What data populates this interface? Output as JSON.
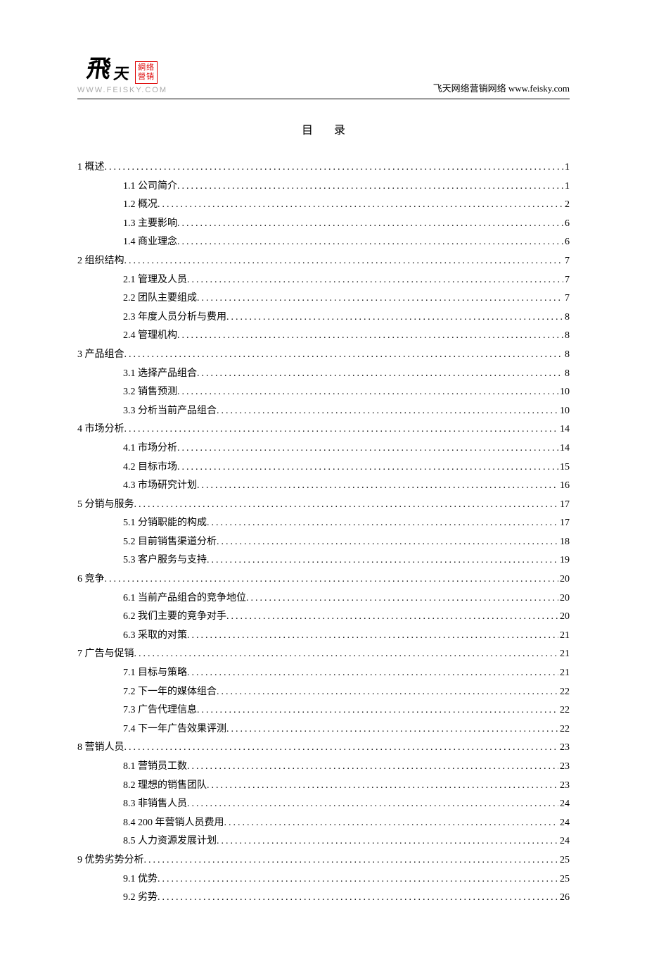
{
  "header": {
    "logo_fly": "飛",
    "logo_tian": "天",
    "logo_red_1": "網络",
    "logo_red_2": "營销",
    "logo_url": "WWW.FEISKY.COM",
    "right_text": "飞天网络营销网络 www.feisky.com"
  },
  "title": "目录",
  "toc": [
    {
      "level": 1,
      "label": "1 概述",
      "page": "1"
    },
    {
      "level": 2,
      "label": "1.1 公司简介",
      "page": "1"
    },
    {
      "level": 2,
      "label": "1.2 概况",
      "page": "2"
    },
    {
      "level": 2,
      "label": "1.3 主要影响",
      "page": "6"
    },
    {
      "level": 2,
      "label": "1.4 商业理念",
      "page": "6"
    },
    {
      "level": 1,
      "label": "2 组织结构",
      "page": "7"
    },
    {
      "level": 2,
      "label": "2.1 管理及人员",
      "page": "7"
    },
    {
      "level": 2,
      "label": "2.2 团队主要组成",
      "page": "7"
    },
    {
      "level": 2,
      "label": "2.3 年度人员分析与费用",
      "page": "8"
    },
    {
      "level": 2,
      "label": "2.4 管理机构",
      "page": "8"
    },
    {
      "level": 1,
      "label": "3 产品组合",
      "page": "8"
    },
    {
      "level": 2,
      "label": "3.1 选择产品组合",
      "page": "8"
    },
    {
      "level": 2,
      "label": "3.2 销售预测",
      "page": "10"
    },
    {
      "level": 2,
      "label": "3.3 分析当前产品组合",
      "page": "10"
    },
    {
      "level": 1,
      "label": "4 市场分析",
      "page": "14"
    },
    {
      "level": 2,
      "label": "4.1 市场分析",
      "page": "14"
    },
    {
      "level": 2,
      "label": "4.2 目标市场",
      "page": "15"
    },
    {
      "level": 2,
      "label": "4.3 市场研究计划",
      "page": "16"
    },
    {
      "level": 1,
      "label": "5 分销与服务",
      "page": "17"
    },
    {
      "level": 2,
      "label": "5.1 分销职能的构成",
      "page": "17"
    },
    {
      "level": 2,
      "label": "5.2 目前销售渠道分析",
      "page": "18"
    },
    {
      "level": 2,
      "label": "5.3 客户服务与支持",
      "page": "19"
    },
    {
      "level": 1,
      "label": "6 竞争",
      "page": "20"
    },
    {
      "level": 2,
      "label": "6.1 当前产品组合的竞争地位",
      "page": "20"
    },
    {
      "level": 2,
      "label": "6.2 我们主要的竞争对手",
      "page": "20"
    },
    {
      "level": 2,
      "label": "6.3 采取的对策",
      "page": "21"
    },
    {
      "level": 1,
      "label": "7 广告与促销",
      "page": "21"
    },
    {
      "level": 2,
      "label": "7.1 目标与策略",
      "page": "21"
    },
    {
      "level": 2,
      "label": "7.2 下一年的媒体组合",
      "page": "22"
    },
    {
      "level": 2,
      "label": "7.3 广告代理信息",
      "page": "22"
    },
    {
      "level": 2,
      "label": "7.4 下一年广告效果评测",
      "page": "22"
    },
    {
      "level": 1,
      "label": "8 营销人员",
      "page": "23"
    },
    {
      "level": 2,
      "label": "8.1 营销员工数",
      "page": "23"
    },
    {
      "level": 2,
      "label": "8.2 理想的销售团队",
      "page": "23"
    },
    {
      "level": 2,
      "label": "8.3 非销售人员",
      "page": "24"
    },
    {
      "level": 2,
      "label": "8.4 200 年营销人员费用",
      "page": "24"
    },
    {
      "level": 2,
      "label": "8.5 人力资源发展计划",
      "page": "24"
    },
    {
      "level": 1,
      "label": "9 优势劣势分析",
      "page": "25"
    },
    {
      "level": 2,
      "label": "9.1 优势",
      "page": "25"
    },
    {
      "level": 2,
      "label": "9.2 劣势",
      "page": "26"
    }
  ]
}
